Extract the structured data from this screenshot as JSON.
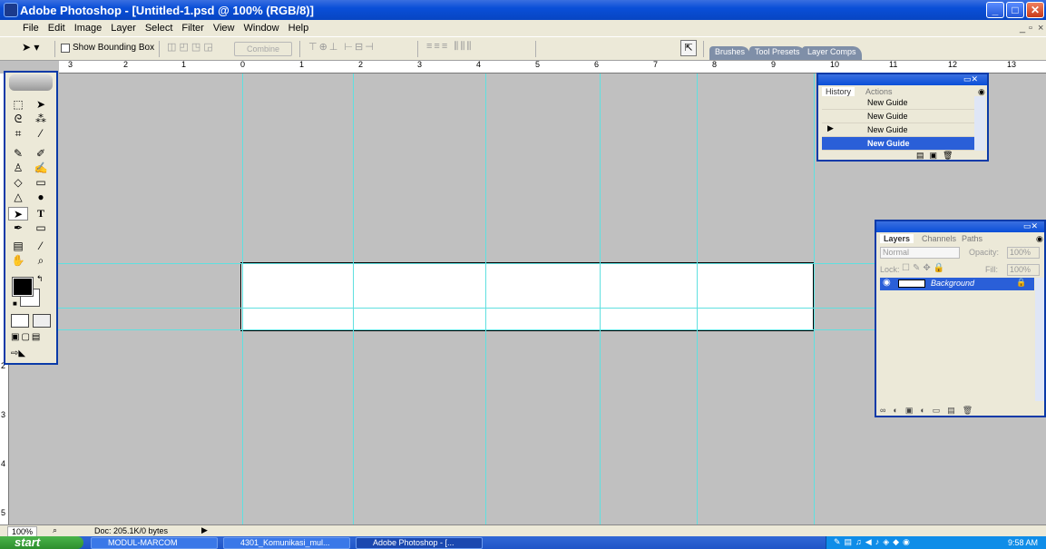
{
  "window": {
    "title": "Adobe Photoshop - [Untitled-1.psd @ 100% (RGB/8)]"
  },
  "menu": [
    "File",
    "Edit",
    "Image",
    "Layer",
    "Select",
    "Filter",
    "View",
    "Window",
    "Help"
  ],
  "options": {
    "show_bounding_box": "Show Bounding Box",
    "combine": "Combine"
  },
  "palette_well": {
    "tabs": [
      "Brushes",
      "Tool Presets",
      "Layer Comps"
    ]
  },
  "ruler": {
    "h_labels": [
      "3",
      "2",
      "1",
      "0",
      "1",
      "2",
      "3",
      "4",
      "5",
      "6",
      "7",
      "8",
      "9",
      "10",
      "11",
      "12",
      "13"
    ],
    "v_labels": [
      "2",
      "3",
      "4",
      "5"
    ]
  },
  "history_panel": {
    "tabs": [
      "History",
      "Actions"
    ],
    "items": [
      {
        "label": "New Guide",
        "selected": false
      },
      {
        "label": "New Guide",
        "selected": false
      },
      {
        "label": "New Guide",
        "selected": false
      },
      {
        "label": "New Guide",
        "selected": true
      }
    ]
  },
  "layers_panel": {
    "tabs": [
      "Layers",
      "Channels",
      "Paths"
    ],
    "blend_mode": "Normal",
    "opacity_label": "Opacity:",
    "opacity_value": "100%",
    "lock_label": "Lock:",
    "fill_label": "Fill:",
    "fill_value": "100%",
    "layers": [
      {
        "name": "Background"
      }
    ]
  },
  "status": {
    "zoom": "100%",
    "doc": "Doc: 205.1K/0 bytes"
  },
  "taskbar": {
    "start": "start",
    "tasks": [
      "MODUL-MARCOM",
      "4301_Komunikasi_mul...",
      "Adobe Photoshop - [..."
    ],
    "time": "9:58 AM"
  }
}
